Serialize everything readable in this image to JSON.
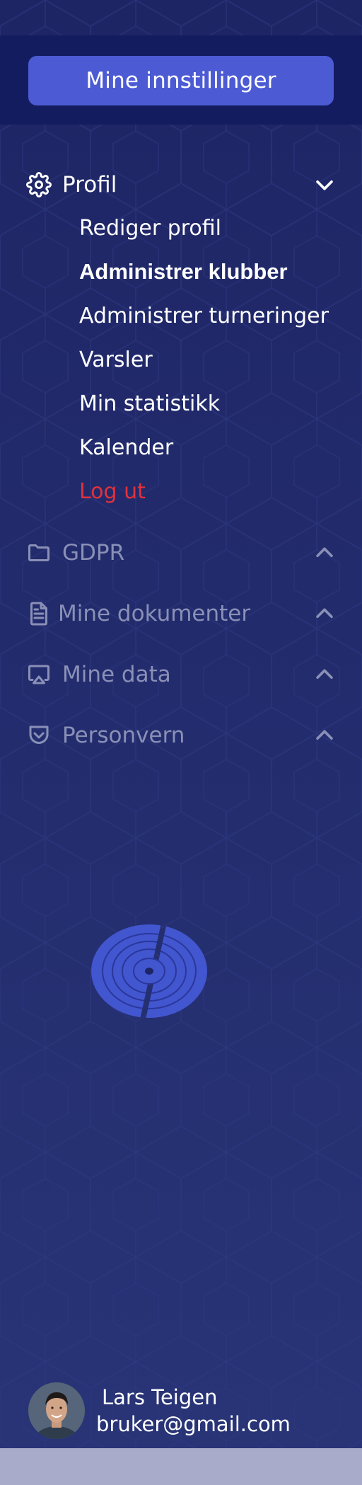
{
  "header": {
    "settings_button_label": "Mine innstillinger"
  },
  "menu": {
    "profile": {
      "label": "Profil",
      "expanded": true,
      "icon": "gear-icon",
      "items": [
        {
          "label": "Rediger profil",
          "active": false
        },
        {
          "label": "Administrer klubber",
          "active": true
        },
        {
          "label": "Administrer turneringer",
          "active": false
        },
        {
          "label": "Varsler",
          "active": false
        },
        {
          "label": "Min statistikk",
          "active": false
        },
        {
          "label": "Kalender",
          "active": false
        }
      ],
      "logout_label": "Log ut"
    },
    "sections": [
      {
        "label": "GDPR",
        "icon": "folder-icon"
      },
      {
        "label": "Mine dokumenter",
        "icon": "document-icon"
      },
      {
        "label": "Mine data",
        "icon": "screen-share-icon"
      },
      {
        "label": "Personvern",
        "icon": "shield-check-icon"
      }
    ]
  },
  "user": {
    "name": "Lars Teigen",
    "email": "bruker@gmail.com"
  },
  "colors": {
    "panel_background": "#222b6c",
    "header_band": "#141c60",
    "accent_button": "#4c5bd4",
    "logout": "#e0323c",
    "muted_text": "#8a90b6",
    "footer_strip": "#a8abc9"
  }
}
